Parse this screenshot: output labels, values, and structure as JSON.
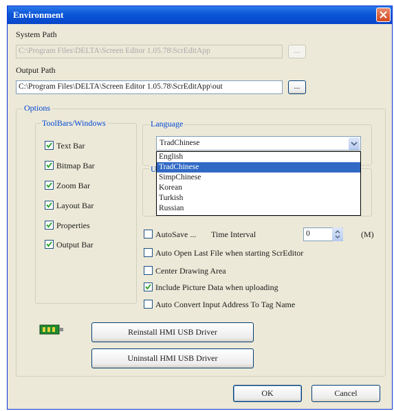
{
  "window": {
    "title": "Environment"
  },
  "system_path": {
    "label": "System Path",
    "value": "C:\\Program Files\\DELTA\\Screen Editor 1.05.78\\ScrEditApp",
    "browse_label": "..."
  },
  "output_path": {
    "label": "Output Path",
    "value": "C:\\Program Files\\DELTA\\Screen Editor 1.05.78\\ScrEditApp\\out",
    "browse_label": "..."
  },
  "options": {
    "label": "Options",
    "toolbars": {
      "label": "ToolBars/Windows",
      "items": [
        {
          "label": "Text Bar",
          "checked": true
        },
        {
          "label": "Bitmap Bar",
          "checked": true
        },
        {
          "label": "Zoom Bar",
          "checked": true
        },
        {
          "label": "Layout Bar",
          "checked": true
        },
        {
          "label": "Properties",
          "checked": true
        },
        {
          "label": "Output Bar",
          "checked": true
        }
      ]
    },
    "language": {
      "label": "Language",
      "selected": "TradChinese",
      "options": [
        "English",
        "TradChinese",
        "SimpChinese",
        "Korean",
        "Turkish",
        "Russian"
      ],
      "hidden_group_fragment": "U"
    },
    "autosave": {
      "label": "AutoSave ...",
      "interval_label": "Time Interval",
      "value": "0",
      "unit": "(M)",
      "checked": false
    },
    "auto_open": {
      "label": "Auto Open Last File when starting ScrEditor",
      "checked": false
    },
    "center_drawing": {
      "label": "Center Drawing Area",
      "checked": false
    },
    "include_picture": {
      "label": "Include Picture Data when uploading",
      "checked": true
    },
    "auto_convert": {
      "label": "Auto Convert Input Address To Tag Name",
      "checked": false
    },
    "reinstall_label": "Reinstall HMI USB Driver",
    "uninstall_label": "Uninstall HMI USB Driver"
  },
  "footer": {
    "ok_label": "OK",
    "cancel_label": "Cancel"
  },
  "colors": {
    "accent": "#0046d5",
    "selection": "#316ac5",
    "titlebar": "#0a56d8"
  }
}
